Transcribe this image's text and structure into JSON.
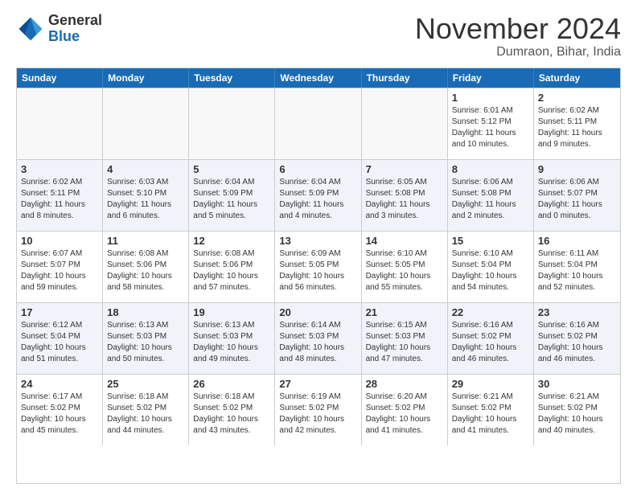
{
  "header": {
    "logo_general": "General",
    "logo_blue": "Blue",
    "month_title": "November 2024",
    "location": "Dumraon, Bihar, India"
  },
  "calendar": {
    "days_of_week": [
      "Sunday",
      "Monday",
      "Tuesday",
      "Wednesday",
      "Thursday",
      "Friday",
      "Saturday"
    ],
    "weeks": [
      [
        {
          "day": "",
          "empty": true
        },
        {
          "day": "",
          "empty": true
        },
        {
          "day": "",
          "empty": true
        },
        {
          "day": "",
          "empty": true
        },
        {
          "day": "",
          "empty": true
        },
        {
          "day": "1",
          "sunrise": "Sunrise: 6:01 AM",
          "sunset": "Sunset: 5:12 PM",
          "daylight": "Daylight: 11 hours and 10 minutes."
        },
        {
          "day": "2",
          "sunrise": "Sunrise: 6:02 AM",
          "sunset": "Sunset: 5:11 PM",
          "daylight": "Daylight: 11 hours and 9 minutes."
        }
      ],
      [
        {
          "day": "3",
          "sunrise": "Sunrise: 6:02 AM",
          "sunset": "Sunset: 5:11 PM",
          "daylight": "Daylight: 11 hours and 8 minutes."
        },
        {
          "day": "4",
          "sunrise": "Sunrise: 6:03 AM",
          "sunset": "Sunset: 5:10 PM",
          "daylight": "Daylight: 11 hours and 6 minutes."
        },
        {
          "day": "5",
          "sunrise": "Sunrise: 6:04 AM",
          "sunset": "Sunset: 5:09 PM",
          "daylight": "Daylight: 11 hours and 5 minutes."
        },
        {
          "day": "6",
          "sunrise": "Sunrise: 6:04 AM",
          "sunset": "Sunset: 5:09 PM",
          "daylight": "Daylight: 11 hours and 4 minutes."
        },
        {
          "day": "7",
          "sunrise": "Sunrise: 6:05 AM",
          "sunset": "Sunset: 5:08 PM",
          "daylight": "Daylight: 11 hours and 3 minutes."
        },
        {
          "day": "8",
          "sunrise": "Sunrise: 6:06 AM",
          "sunset": "Sunset: 5:08 PM",
          "daylight": "Daylight: 11 hours and 2 minutes."
        },
        {
          "day": "9",
          "sunrise": "Sunrise: 6:06 AM",
          "sunset": "Sunset: 5:07 PM",
          "daylight": "Daylight: 11 hours and 0 minutes."
        }
      ],
      [
        {
          "day": "10",
          "sunrise": "Sunrise: 6:07 AM",
          "sunset": "Sunset: 5:07 PM",
          "daylight": "Daylight: 10 hours and 59 minutes."
        },
        {
          "day": "11",
          "sunrise": "Sunrise: 6:08 AM",
          "sunset": "Sunset: 5:06 PM",
          "daylight": "Daylight: 10 hours and 58 minutes."
        },
        {
          "day": "12",
          "sunrise": "Sunrise: 6:08 AM",
          "sunset": "Sunset: 5:06 PM",
          "daylight": "Daylight: 10 hours and 57 minutes."
        },
        {
          "day": "13",
          "sunrise": "Sunrise: 6:09 AM",
          "sunset": "Sunset: 5:05 PM",
          "daylight": "Daylight: 10 hours and 56 minutes."
        },
        {
          "day": "14",
          "sunrise": "Sunrise: 6:10 AM",
          "sunset": "Sunset: 5:05 PM",
          "daylight": "Daylight: 10 hours and 55 minutes."
        },
        {
          "day": "15",
          "sunrise": "Sunrise: 6:10 AM",
          "sunset": "Sunset: 5:04 PM",
          "daylight": "Daylight: 10 hours and 54 minutes."
        },
        {
          "day": "16",
          "sunrise": "Sunrise: 6:11 AM",
          "sunset": "Sunset: 5:04 PM",
          "daylight": "Daylight: 10 hours and 52 minutes."
        }
      ],
      [
        {
          "day": "17",
          "sunrise": "Sunrise: 6:12 AM",
          "sunset": "Sunset: 5:04 PM",
          "daylight": "Daylight: 10 hours and 51 minutes."
        },
        {
          "day": "18",
          "sunrise": "Sunrise: 6:13 AM",
          "sunset": "Sunset: 5:03 PM",
          "daylight": "Daylight: 10 hours and 50 minutes."
        },
        {
          "day": "19",
          "sunrise": "Sunrise: 6:13 AM",
          "sunset": "Sunset: 5:03 PM",
          "daylight": "Daylight: 10 hours and 49 minutes."
        },
        {
          "day": "20",
          "sunrise": "Sunrise: 6:14 AM",
          "sunset": "Sunset: 5:03 PM",
          "daylight": "Daylight: 10 hours and 48 minutes."
        },
        {
          "day": "21",
          "sunrise": "Sunrise: 6:15 AM",
          "sunset": "Sunset: 5:03 PM",
          "daylight": "Daylight: 10 hours and 47 minutes."
        },
        {
          "day": "22",
          "sunrise": "Sunrise: 6:16 AM",
          "sunset": "Sunset: 5:02 PM",
          "daylight": "Daylight: 10 hours and 46 minutes."
        },
        {
          "day": "23",
          "sunrise": "Sunrise: 6:16 AM",
          "sunset": "Sunset: 5:02 PM",
          "daylight": "Daylight: 10 hours and 46 minutes."
        }
      ],
      [
        {
          "day": "24",
          "sunrise": "Sunrise: 6:17 AM",
          "sunset": "Sunset: 5:02 PM",
          "daylight": "Daylight: 10 hours and 45 minutes."
        },
        {
          "day": "25",
          "sunrise": "Sunrise: 6:18 AM",
          "sunset": "Sunset: 5:02 PM",
          "daylight": "Daylight: 10 hours and 44 minutes."
        },
        {
          "day": "26",
          "sunrise": "Sunrise: 6:18 AM",
          "sunset": "Sunset: 5:02 PM",
          "daylight": "Daylight: 10 hours and 43 minutes."
        },
        {
          "day": "27",
          "sunrise": "Sunrise: 6:19 AM",
          "sunset": "Sunset: 5:02 PM",
          "daylight": "Daylight: 10 hours and 42 minutes."
        },
        {
          "day": "28",
          "sunrise": "Sunrise: 6:20 AM",
          "sunset": "Sunset: 5:02 PM",
          "daylight": "Daylight: 10 hours and 41 minutes."
        },
        {
          "day": "29",
          "sunrise": "Sunrise: 6:21 AM",
          "sunset": "Sunset: 5:02 PM",
          "daylight": "Daylight: 10 hours and 41 minutes."
        },
        {
          "day": "30",
          "sunrise": "Sunrise: 6:21 AM",
          "sunset": "Sunset: 5:02 PM",
          "daylight": "Daylight: 10 hours and 40 minutes."
        }
      ]
    ]
  }
}
